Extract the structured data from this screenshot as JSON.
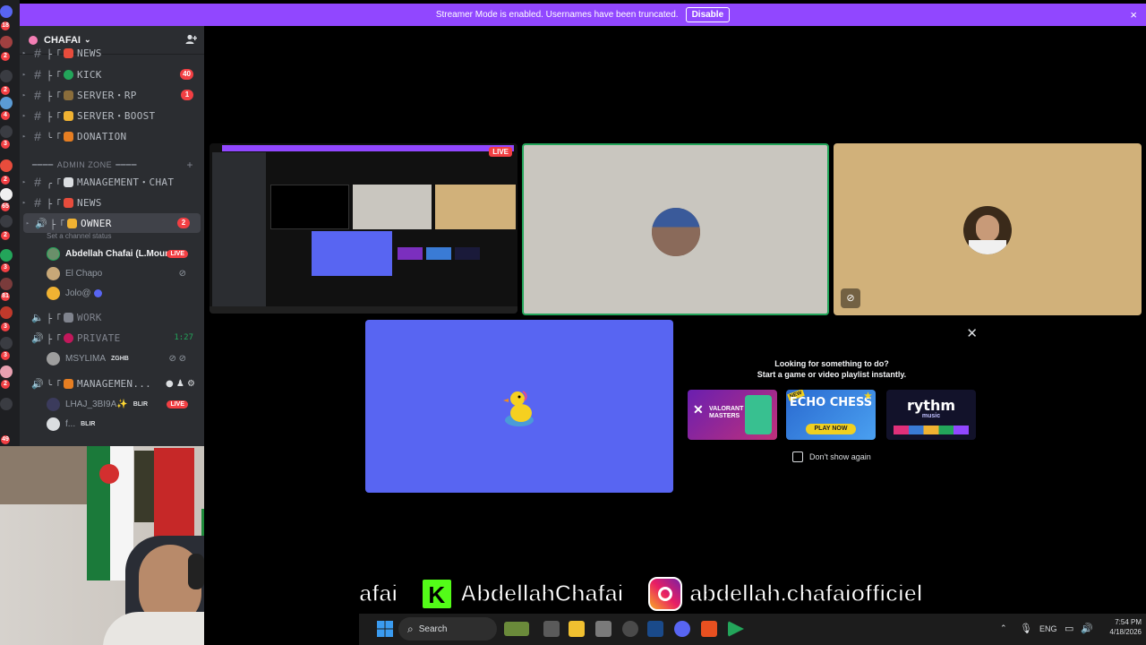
{
  "banner": {
    "message": "Streamer Mode is enabled. Usernames have been truncated.",
    "disable_label": "Disable",
    "close_icon": "×"
  },
  "server": {
    "name": "CHAFAI",
    "chevron": "⌄",
    "invite_icon": "person-add-icon"
  },
  "server_strip": {
    "badges": [
      "18",
      "2",
      "2",
      "4",
      "3",
      "2",
      "65",
      "2",
      "3",
      "81",
      "3",
      "3",
      "2",
      "49"
    ]
  },
  "channels": {
    "partial_top": "NEWS",
    "items": [
      {
        "name": "KICK",
        "badge": "40",
        "emoji_color": "#23a55a"
      },
      {
        "name": "SERVER・RP",
        "badge": "1",
        "emoji_color": "#8a6d3b"
      },
      {
        "name": "SERVER・BOOST",
        "badge": "",
        "emoji_color": "#f0b232"
      },
      {
        "name": "DONATION",
        "badge": "",
        "emoji_color": "#e67e22"
      }
    ],
    "category_admin": "ADMIN ZONE",
    "admin_items": [
      {
        "name": "MANAGEMENT・CHAT",
        "emoji_color": "#dbdee1"
      },
      {
        "name": "NEWS",
        "emoji_color": "#e74c3c"
      }
    ],
    "owner": {
      "name": "OWNER",
      "badge": "2",
      "status": "Set a channel status"
    },
    "members_owner": [
      {
        "name": "Abdellah Chafai (L.Mount...",
        "live": "LIVE"
      },
      {
        "name": "El Chapo"
      },
      {
        "name": "Jolo@"
      }
    ],
    "work": {
      "name": "WORK"
    },
    "private": {
      "name": "PRIVATE",
      "time": "1:27"
    },
    "members_private": [
      {
        "name": "MSYLIMA",
        "tag": "ZGHB"
      }
    ],
    "management": {
      "name": "MANAGEMEN..."
    },
    "members_management": [
      {
        "name": "LHAJ_3BI9A✨",
        "tag": "BLIR",
        "live": "LIVE"
      },
      {
        "name": "f...",
        "tag": "BLIR"
      }
    ]
  },
  "activity": {
    "line1": "Looking for something to do?",
    "line2": "Start a game or video playlist instantly.",
    "cards": [
      {
        "title": "VALORANT MASTERS",
        "color": "#7b2fbe"
      },
      {
        "title": "ECHO CHESS",
        "sub": "PLAY NOW",
        "badge": "NEW",
        "color": "#3a7bd5"
      },
      {
        "title": "rythm",
        "sub": "music",
        "color": "#1a1a3a"
      }
    ],
    "checkbox_label": "Don't show again"
  },
  "social": {
    "kick_partial": "afai",
    "kick_handle": "AbdellahChafai",
    "instagram_handle": "abdellah.chafaiofficiel"
  },
  "taskbar": {
    "search_label": "Search",
    "lang": "ENG",
    "time": "7:54 PM",
    "date": "4/18/2026"
  },
  "colors": {
    "banner": "#9147ff",
    "sidebar": "#2b2d31",
    "tile_gray": "#c9c6bf",
    "tile_tan": "#d1b17a",
    "tile_blue": "#5865f2",
    "live_red": "#f23f43",
    "speaking_green": "#23a55a"
  },
  "icons": {
    "mute": "🎙",
    "speaker": "🔊"
  }
}
